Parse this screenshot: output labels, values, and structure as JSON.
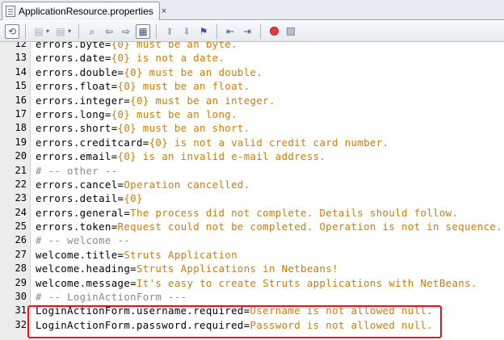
{
  "tab": {
    "title": "ApplicationResource.properties",
    "close": "×"
  },
  "toolbar": {
    "buttons": [
      "history-icon",
      "back-icon",
      "forward-icon",
      "find-icon",
      "find-previous-icon",
      "find-next-icon",
      "toggle-highlight-icon",
      "prev-bookmark-icon",
      "next-bookmark-icon",
      "toggle-bookmark-icon",
      "shift-left-icon",
      "shift-right-icon",
      "record-macro-icon",
      "stop-macro-icon"
    ]
  },
  "colors": {
    "value": "#ce7b00",
    "comment": "#8a8a8a",
    "highlight": "#e0141e"
  },
  "lines": [
    {
      "n": "12",
      "key": "errors.byte=",
      "value": "{0} must be an byte."
    },
    {
      "n": "13",
      "key": "errors.date=",
      "value": "{0} is not a date."
    },
    {
      "n": "14",
      "key": "errors.double=",
      "value": "{0} must be an double."
    },
    {
      "n": "15",
      "key": "errors.float=",
      "value": "{0} must be an float."
    },
    {
      "n": "16",
      "key": "errors.integer=",
      "value": "{0} must be an integer."
    },
    {
      "n": "17",
      "key": "errors.long=",
      "value": "{0} must be an long."
    },
    {
      "n": "18",
      "key": "errors.short=",
      "value": "{0} must be an short."
    },
    {
      "n": "19",
      "key": "errors.creditcard=",
      "value": "{0} is not a valid credit card number."
    },
    {
      "n": "20",
      "key": "errors.email=",
      "value": "{0} is an invalid e-mail address."
    },
    {
      "n": "21",
      "comment": "# -- other --"
    },
    {
      "n": "22",
      "key": "errors.cancel=",
      "value": "Operation cancelled."
    },
    {
      "n": "23",
      "key": "errors.detail=",
      "value": "{0}"
    },
    {
      "n": "24",
      "key": "errors.general=",
      "value": "The process did not complete. Details should follow."
    },
    {
      "n": "25",
      "key": "errors.token=",
      "value": "Request could not be completed. Operation is not in sequence."
    },
    {
      "n": "26",
      "comment": "# -- welcome --"
    },
    {
      "n": "27",
      "key": "welcome.title=",
      "value": "Struts Application"
    },
    {
      "n": "28",
      "key": "welcome.heading=",
      "value": "Struts Applications in Netbeans!"
    },
    {
      "n": "29",
      "key": "welcome.message=",
      "value": "It's easy to create Struts applications with NetBeans."
    },
    {
      "n": "30",
      "comment": "# -- LoginActionForm ---"
    },
    {
      "n": "31",
      "key": "LoginActionForm.username.required=",
      "value": "Username is not allowed null."
    },
    {
      "n": "32",
      "key": "LoginActionForm.password.required=",
      "value": "Password is not allowed null."
    }
  ]
}
